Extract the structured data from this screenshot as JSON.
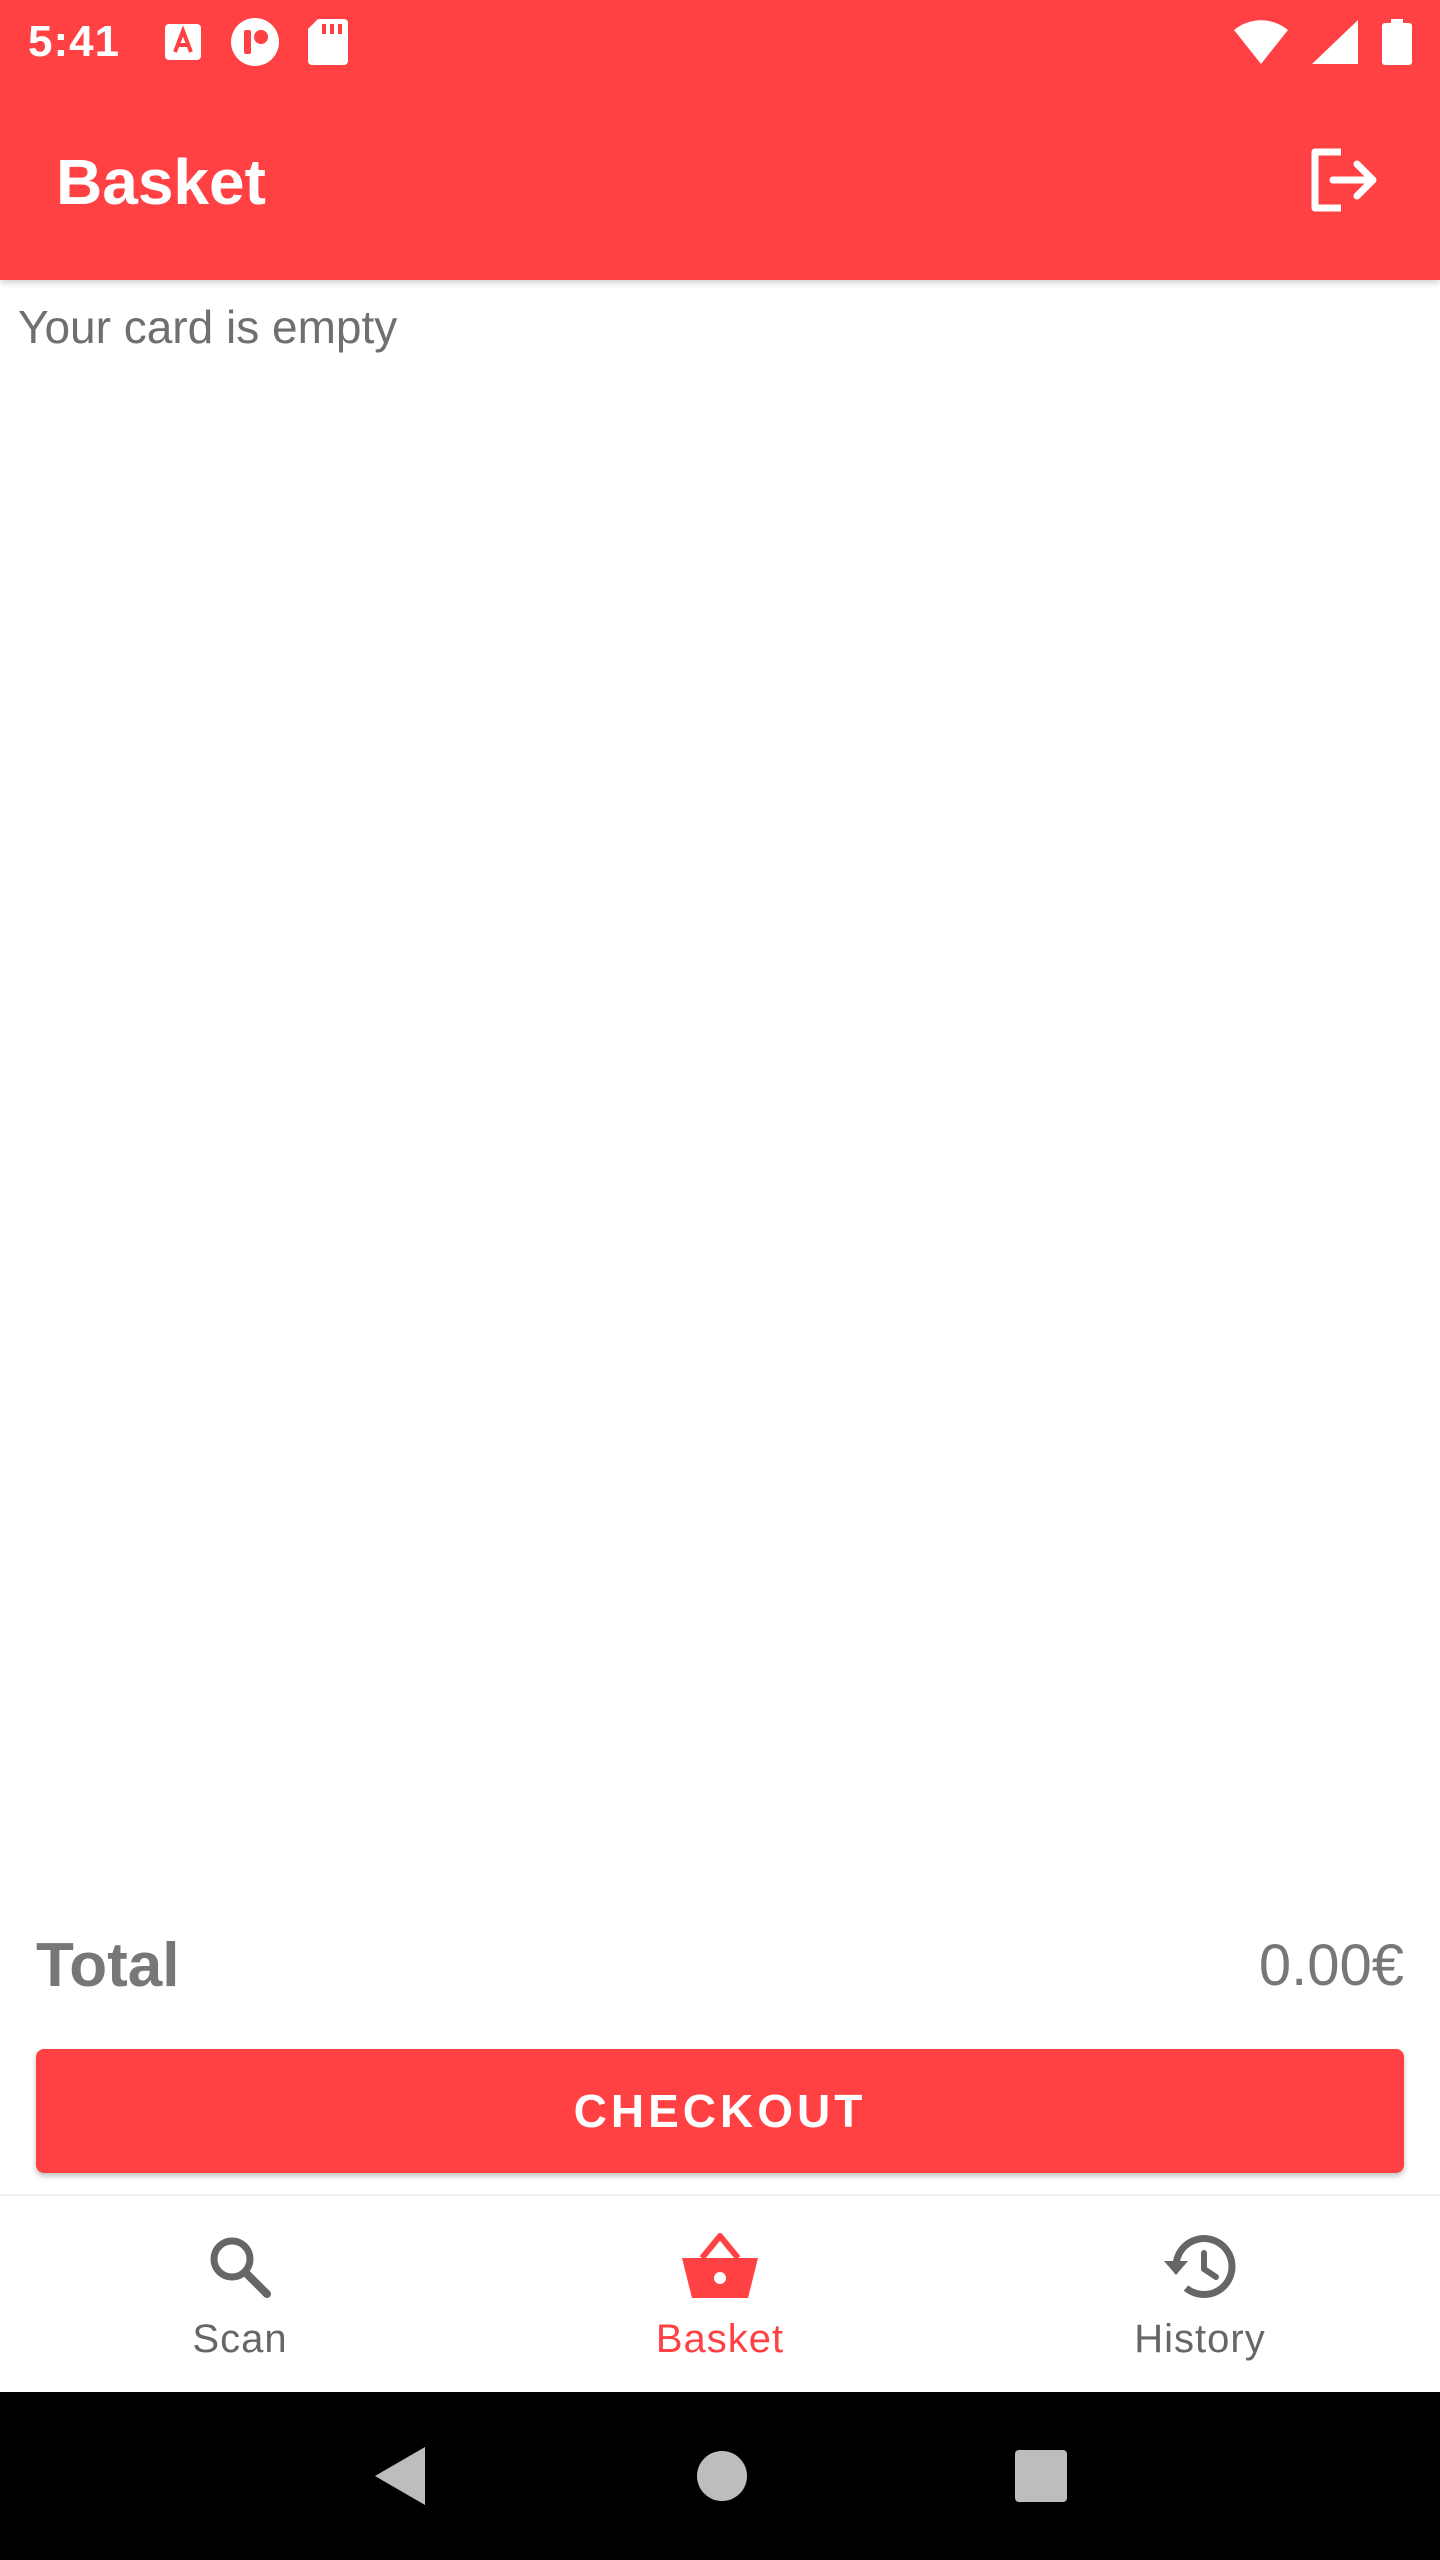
{
  "colors": {
    "accent": "#ff4144",
    "muted_text": "#6f6f6f",
    "nav_inactive": "#666666"
  },
  "status_bar": {
    "time": "5:41",
    "icons": [
      "autofill-a-icon",
      "media-app-icon",
      "sd-card-icon",
      "wifi-icon",
      "signal-icon",
      "battery-icon"
    ]
  },
  "app_bar": {
    "title": "Basket",
    "action_icon": "logout-icon"
  },
  "basket": {
    "empty_message": "Your card is empty"
  },
  "summary": {
    "total_label": "Total",
    "total_value": "0.00€"
  },
  "checkout": {
    "label": "CHECKOUT"
  },
  "bottom_nav": {
    "items": [
      {
        "label": "Scan",
        "icon": "search-icon",
        "active": false
      },
      {
        "label": "Basket",
        "icon": "basket-icon",
        "active": true
      },
      {
        "label": "History",
        "icon": "history-icon",
        "active": false
      }
    ]
  },
  "system_nav": {
    "buttons": [
      "back-icon",
      "home-icon",
      "recents-icon"
    ]
  }
}
